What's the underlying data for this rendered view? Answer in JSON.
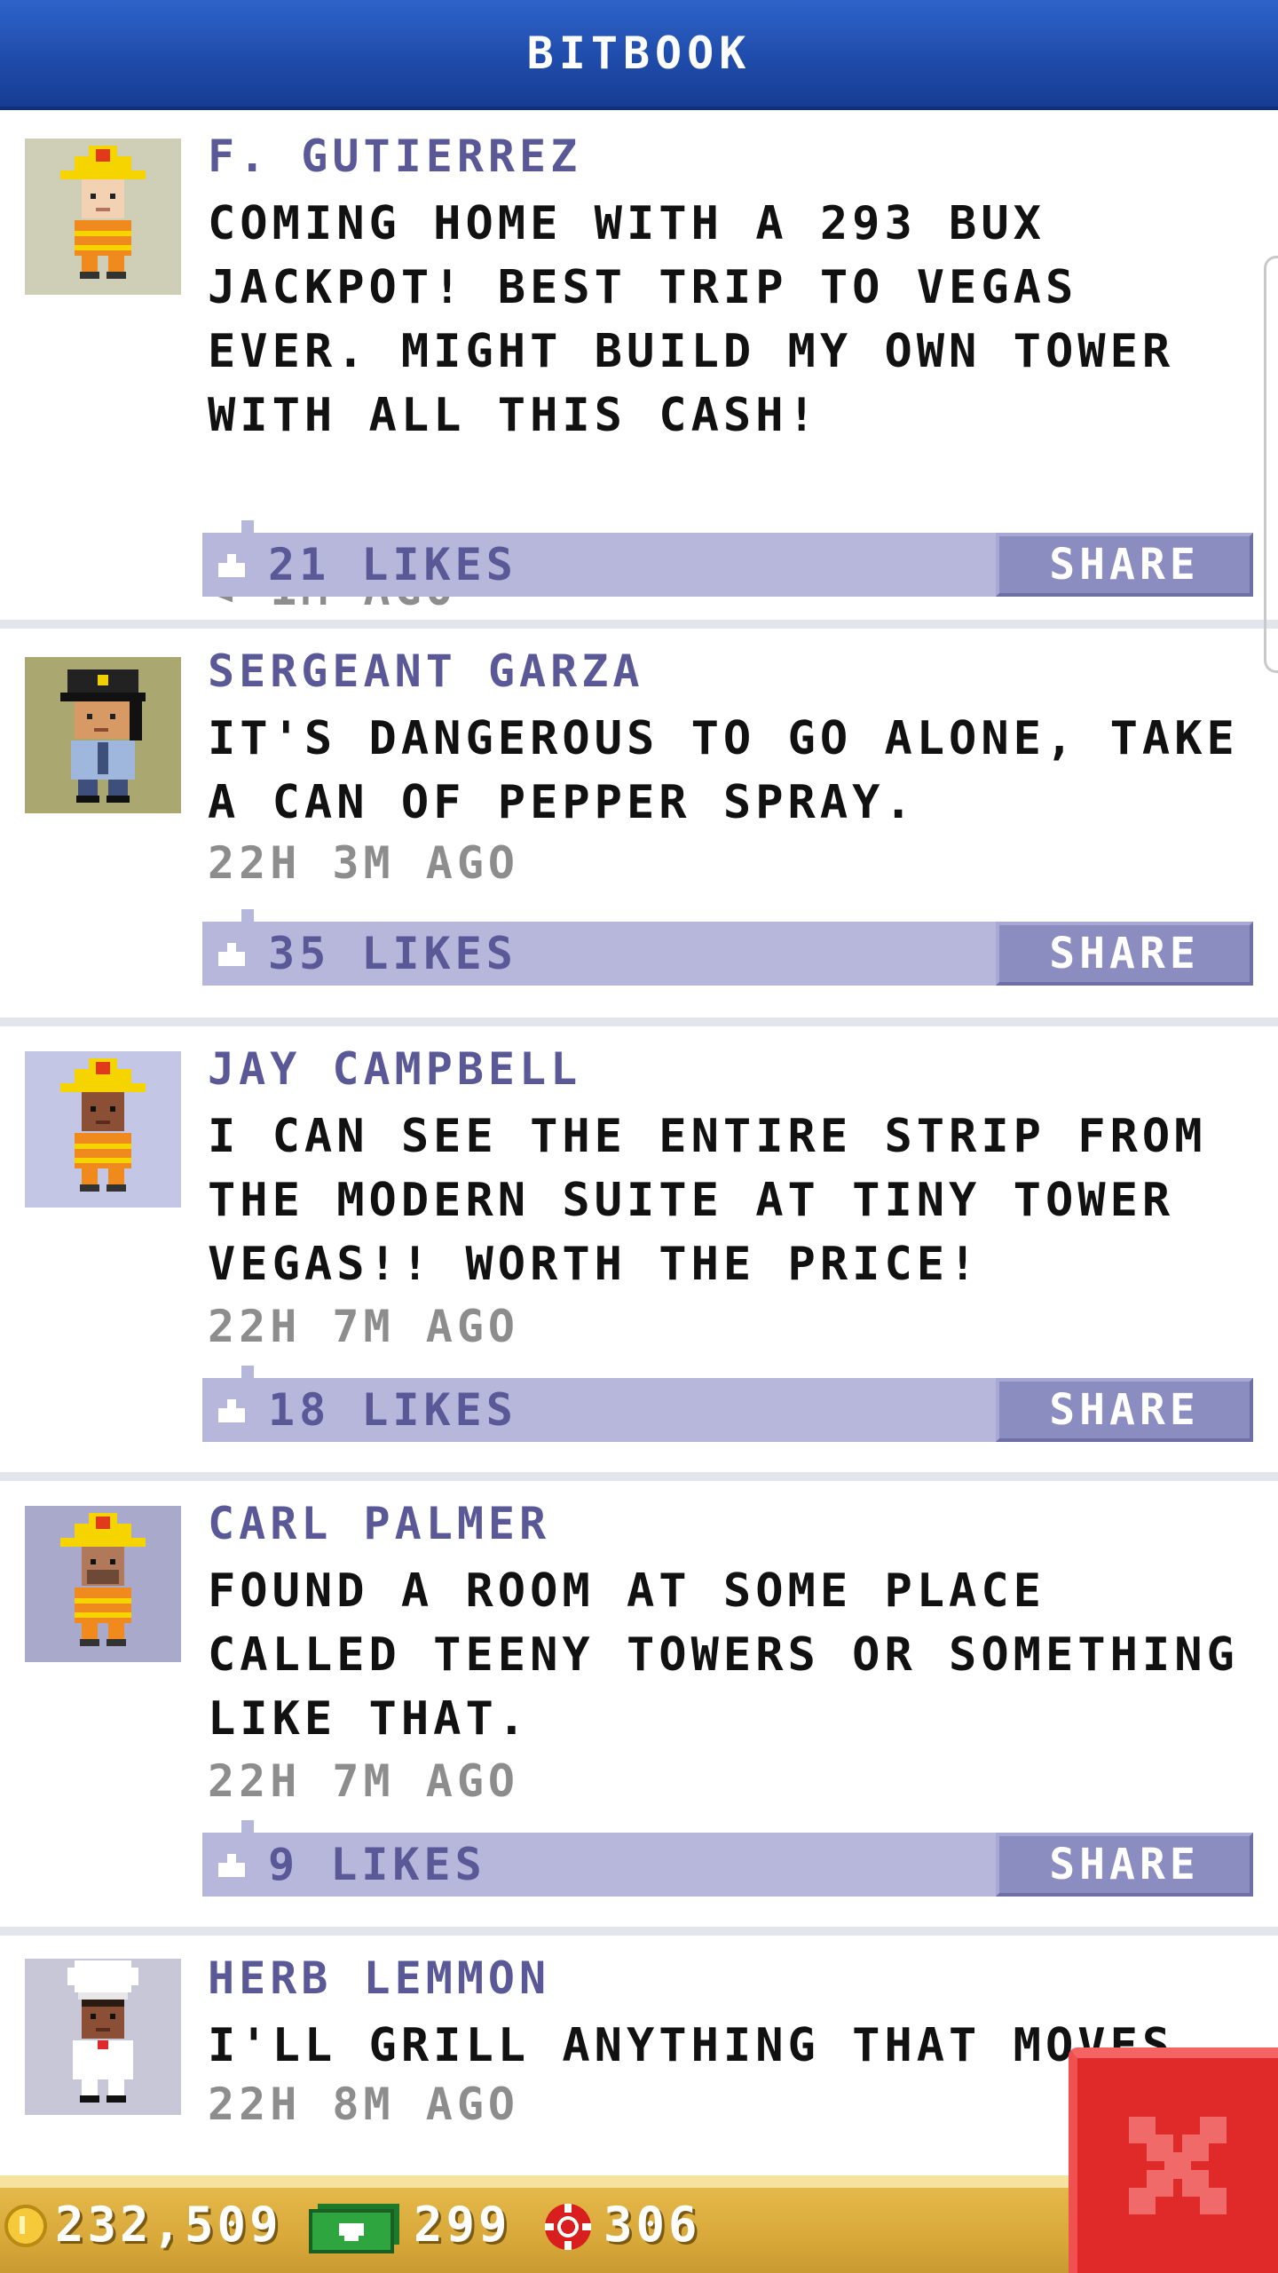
{
  "header": {
    "title": "BITBOOK"
  },
  "posts": [
    {
      "name": "F. GUTIERREZ",
      "text": "COMING HOME WITH A 293 BUX JACKPOT! BEST TRIP TO VEGAS EVER. MIGHT BUILD MY OWN TOWER WITH ALL THIS CASH!",
      "time": "< 1M AGO",
      "likes": "21 LIKES",
      "share_label": "SHARE",
      "avatar": "firefighter-avatar"
    },
    {
      "name": "SERGEANT GARZA",
      "text": "IT'S DANGEROUS TO GO ALONE, TAKE A CAN OF PEPPER SPRAY.",
      "time": "22H 3M AGO",
      "likes": "35 LIKES",
      "share_label": "SHARE",
      "avatar": "police-officer-avatar"
    },
    {
      "name": "JAY CAMPBELL",
      "text": "I CAN SEE THE ENTIRE STRIP FROM THE MODERN SUITE AT TINY TOWER VEGAS!! WORTH THE PRICE!",
      "time": "22H 7M AGO",
      "likes": "18 LIKES",
      "share_label": "SHARE",
      "avatar": "firefighter-avatar"
    },
    {
      "name": "CARL PALMER",
      "text": "FOUND A ROOM AT SOME PLACE CALLED TEENY TOWERS OR SOMETHING LIKE THAT.",
      "time": "22H 7M AGO",
      "likes": "9 LIKES",
      "share_label": "SHARE",
      "avatar": "firefighter-avatar"
    },
    {
      "name": "HERB LEMMON",
      "text": "I'LL GRILL ANYTHING THAT MOVES",
      "time": "22H 8M AGO",
      "avatar": "chef-avatar"
    }
  ],
  "currency": {
    "coins": "232,509",
    "bux": "299",
    "chips": "306"
  },
  "colors": {
    "header_blue": "#1e4aa8",
    "name_purple": "#5a5897",
    "like_bar": "#b6b7db",
    "share_button": "#8b8cc0",
    "close_red": "#e02a2a",
    "bottom_gold": "#d9a93a"
  },
  "icons": [
    "like-icon",
    "coin-icon",
    "bux-icon",
    "chip-icon",
    "close-icon"
  ]
}
